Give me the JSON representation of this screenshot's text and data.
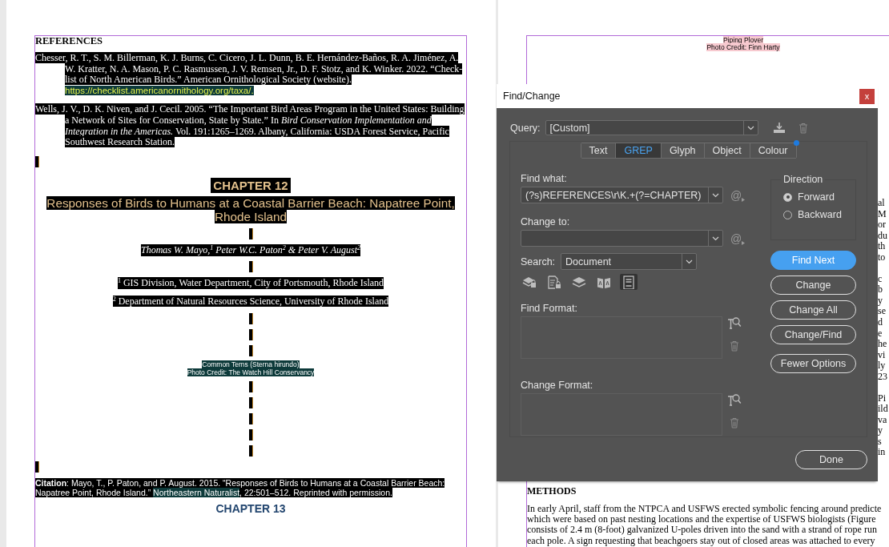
{
  "left_page": {
    "blocks": [
      {
        "kind": "heading",
        "text": "REFERENCES"
      },
      {
        "kind": "reference",
        "text": "Chesser, R. T., S. M. Billerman, K. J. Burns, C. Cicero, J. L. Dunn, B. E. Hernández-Baños, R. A. Jiménez, A. W. Kratter, N. A. Mason, P. C. Rasmussen, J. V. Remsen, Jr., D. F. Stotz, and K. Winker. 2022. “Check-list of North American Birds.” American Ornithological Society (website).",
        "link": "https://checklist.americanornithology.org/taxa/."
      },
      {
        "kind": "reference",
        "text": "Wells, J. V., D. K. Niven, and J. Cecil. 2005. “The Important Bird Areas Program in the United States: Building a Network of Sites for Conservation, State by State.” In *Bird Conservation Implementation and Integration in the Americas.* Vol. 191:1265–1269. Albany, California: USDA Forest Service, Pacific Southwest Research Station."
      },
      {
        "kind": "blank_left"
      },
      {
        "kind": "chapter",
        "text": "CHAPTER 12"
      },
      {
        "kind": "title",
        "text": "Responses of Birds to Humans at a Coastal Barrier Beach: Napatree Point, Rhode Island"
      },
      {
        "kind": "blank"
      },
      {
        "kind": "authors",
        "text": "Thomas W. Mayo,$^{1}$ Peter W.C. Paton$^{2}$ & Peter V. August$^{2}$"
      },
      {
        "kind": "blank"
      },
      {
        "kind": "affiliation",
        "text": "$^{1}$ GIS Division, Water Department, City of Portsmouth, Rhode Island"
      },
      {
        "kind": "affiliation",
        "text": "$^{2}$ Department of Natural Resources Science, University of Rhode Island"
      },
      {
        "kind": "blank"
      },
      {
        "kind": "blank"
      },
      {
        "kind": "blank"
      },
      {
        "kind": "caption",
        "lines": [
          "Common Terns (Sterna hirundo)",
          "Photo Credit: The Watch Hill Conservancy"
        ]
      },
      {
        "kind": "blank"
      },
      {
        "kind": "blank"
      },
      {
        "kind": "blank"
      },
      {
        "kind": "blank"
      },
      {
        "kind": "blank"
      },
      {
        "kind": "blank_left"
      },
      {
        "kind": "citation",
        "label": "Citation",
        "before": ": Mayo, T., P. Paton, and P. August. 2015. “Responses of Birds to Humans at a Coastal Barrier Beach: Napatree Point, Rhode Island.” ",
        "journal": "Northeastern Naturalist",
        "after": ", 22:501–512. Reprinted with permission."
      },
      {
        "kind": "next_chapter",
        "text": "CHAPTER 13"
      }
    ]
  },
  "right_page": {
    "caption": [
      "Piping Plover",
      "Photo Credit: Finn Harty"
    ],
    "edge_fragments": [
      [
        "al",
        "M",
        "or",
        "du",
        "th",
        "to"
      ],
      [
        "c",
        "b",
        "y",
        "se",
        "d",
        "e",
        "he",
        "vi",
        "ly",
        "23"
      ],
      [
        "Pi",
        "ild",
        "va",
        "y",
        "s",
        "in"
      ]
    ],
    "section_heading": "METHODS",
    "paragraph_lines": [
      "In early April, staff from the NTPCA and USFWS erected symbolic fencing around predicte",
      "which were based on past nesting locations and the expertise of USFWS biologists (Figure",
      "consists of 2.4 m (8-foot) galvanized U-poles driven into the sand with a strand of rope run",
      "each pole. A sign requesting that beachgoers stay out of closed areas was attached to every"
    ]
  },
  "dialog": {
    "title": "Find/Change",
    "close": "x",
    "query": {
      "label": "Query:",
      "value": "[Custom]"
    },
    "tabs": [
      {
        "label": "Text",
        "selected": false
      },
      {
        "label": "GREP",
        "selected": true
      },
      {
        "label": "Glyph",
        "selected": false
      },
      {
        "label": "Object",
        "selected": false
      },
      {
        "label": "Colour",
        "selected": false
      }
    ],
    "find_what": {
      "label": "Find what:",
      "value": "(?s)REFERENCES\\r\\K.+(?=CHAPTER)",
      "special": "@"
    },
    "change_to": {
      "label": "Change to:",
      "special": "@"
    },
    "search": {
      "label": "Search:",
      "value": "Document"
    },
    "options": [
      {
        "kind": "locked-layers",
        "on": false
      },
      {
        "kind": "locked-stories",
        "on": false
      },
      {
        "kind": "hidden-layers",
        "on": false
      },
      {
        "kind": "master-pages",
        "on": false
      },
      {
        "kind": "footnotes",
        "on": true
      }
    ],
    "find_format": {
      "label": "Find Format:"
    },
    "change_format": {
      "label": "Change Format:"
    },
    "direction": {
      "label": "Direction",
      "options": [
        {
          "label": "Forward",
          "selected": true
        },
        {
          "label": "Backward",
          "selected": false
        }
      ]
    },
    "buttons": [
      {
        "label": "Find Next",
        "primary": true
      },
      {
        "label": "Change",
        "primary": false
      },
      {
        "label": "Change All",
        "primary": false
      },
      {
        "label": "Change/Find",
        "primary": false
      },
      {
        "label": "Fewer Options",
        "primary": false
      }
    ],
    "done": "Done"
  }
}
